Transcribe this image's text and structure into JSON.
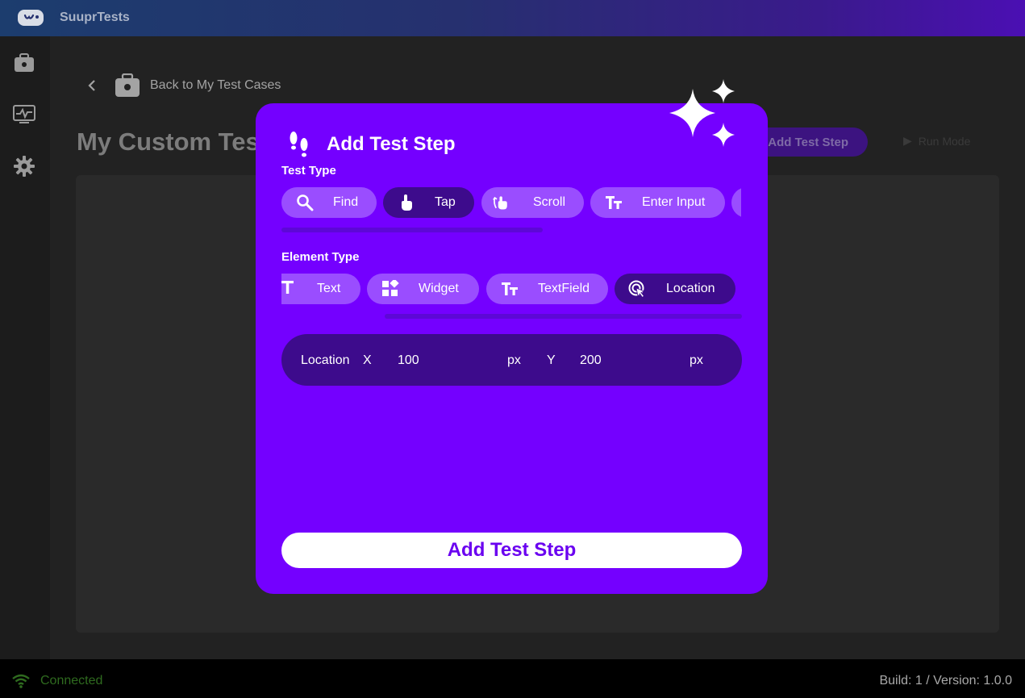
{
  "app": {
    "title": "SuuprTests"
  },
  "main": {
    "back_label": "Back to My Test Cases",
    "page_title": "My Custom Test",
    "add_test_step_label": "Add Test Step",
    "run_label": "Run Mode"
  },
  "modal": {
    "title": "Add Test Step",
    "test_type_label": "Test Type",
    "test_types": [
      {
        "label": "Find",
        "icon": "search-icon",
        "selected": false
      },
      {
        "label": "Tap",
        "icon": "tap-hand-icon",
        "selected": true
      },
      {
        "label": "Scroll",
        "icon": "scroll-gesture-icon",
        "selected": false
      },
      {
        "label": "Enter Input",
        "icon": "text-format-icon",
        "selected": false
      }
    ],
    "element_type_label": "Element Type",
    "element_types": [
      {
        "label": "Text",
        "icon": "text-icon",
        "selected": false
      },
      {
        "label": "Widget",
        "icon": "widgets-icon",
        "selected": false
      },
      {
        "label": "TextField",
        "icon": "text-format-icon",
        "selected": false
      },
      {
        "label": "Location",
        "icon": "location-tap-icon",
        "selected": true
      }
    ],
    "location": {
      "label": "Location",
      "x_label": "X",
      "x_value": "100",
      "x_unit": "px",
      "y_label": "Y",
      "y_value": "200",
      "y_unit": "px"
    },
    "submit_label": "Add Test Step"
  },
  "status": {
    "connection": "Connected",
    "build": "Build: 1 / Version: 1.0.0"
  },
  "colors": {
    "modal_bg": "#7400ff",
    "chip_bg": "#9a4dff",
    "chip_selected_bg": "#3d0b8c",
    "connected": "#2f6b1f"
  }
}
